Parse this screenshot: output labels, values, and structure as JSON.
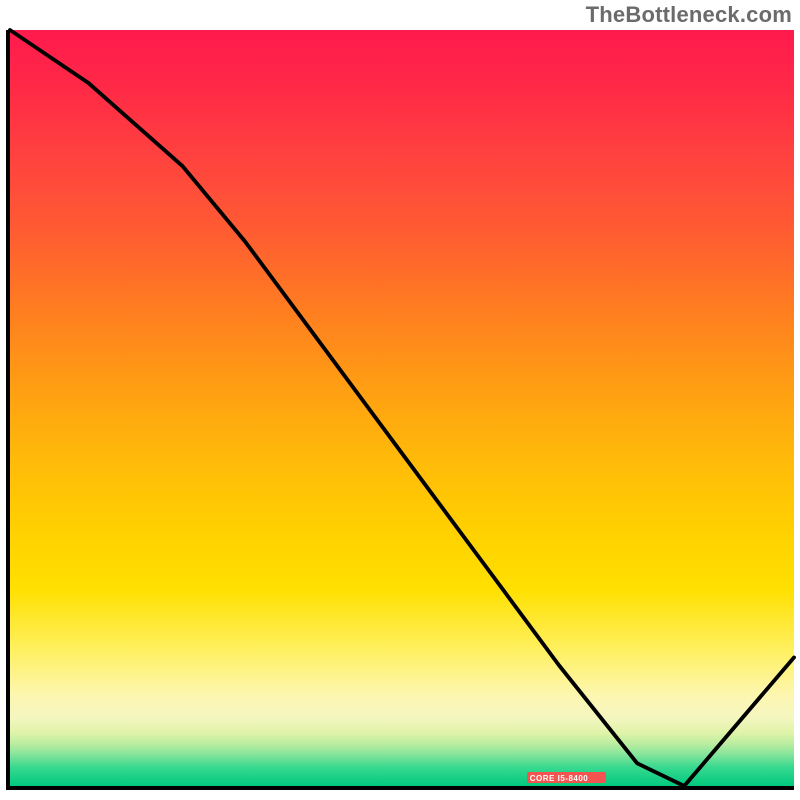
{
  "brand": {
    "watermark": "TheBottleneck.com"
  },
  "chart_data": {
    "type": "line",
    "title": "",
    "xlabel": "",
    "ylabel": "",
    "xlim": [
      0,
      100
    ],
    "ylim": [
      0,
      100
    ],
    "grid": false,
    "series": [
      {
        "name": "bottleneck-curve",
        "x": [
          0,
          10,
          22,
          30,
          40,
          50,
          60,
          70,
          80,
          86,
          100
        ],
        "y": [
          100,
          93,
          82,
          72,
          58,
          44,
          30,
          16,
          3,
          0,
          17
        ]
      }
    ],
    "annotations": [
      {
        "name": "core-label",
        "text": "CORE I5-8400",
        "x": 83,
        "y": 1
      }
    ],
    "background_gradient": {
      "top_color": "#ff1a4d",
      "mid_color": "#ffd000",
      "bottom_color": "#00c97e"
    }
  }
}
